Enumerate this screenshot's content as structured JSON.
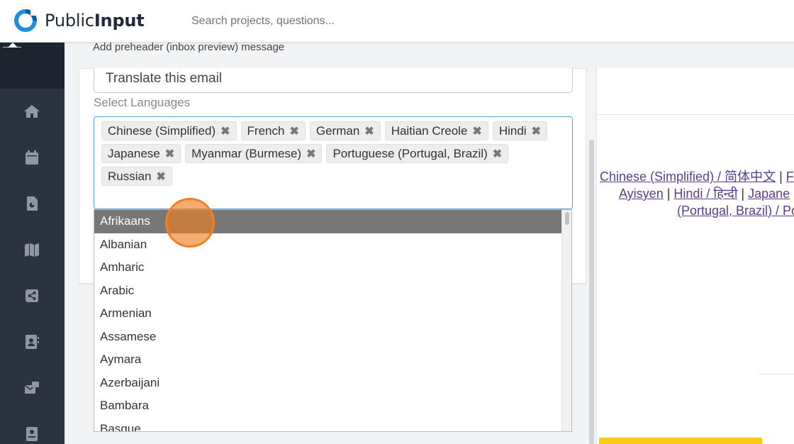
{
  "header": {
    "brand_part1": "Public",
    "brand_part2": "Input",
    "search_placeholder": "Search projects, questions..."
  },
  "sidebar": {
    "items": [
      {
        "name": "home-icon"
      },
      {
        "name": "calendar-icon"
      },
      {
        "name": "document-icon"
      },
      {
        "name": "map-icon"
      },
      {
        "name": "share-icon"
      },
      {
        "name": "contacts-icon"
      },
      {
        "name": "email-icon"
      },
      {
        "name": "book-icon"
      }
    ]
  },
  "main": {
    "preheader_label": "Add preheader (inbox preview) message",
    "translate_label": "Translate this email",
    "select_label": "Select Languages",
    "selected_languages": [
      "Chinese (Simplified)",
      "French",
      "German",
      "Haitian Creole",
      "Hindi",
      "Japanese",
      "Myanmar (Burmese)",
      "Portuguese (Portugal, Brazil)",
      "Russian"
    ],
    "tag_remove_glyph": "✖",
    "dropdown_options": [
      "Afrikaans",
      "Albanian",
      "Amharic",
      "Arabic",
      "Armenian",
      "Assamese",
      "Aymara",
      "Azerbaijani",
      "Bambara",
      "Basque"
    ],
    "highlighted_option": "Afrikaans"
  },
  "preview": {
    "line1_link1": "Chinese (Simplified) / 简体中文",
    "line1_sep": " | ",
    "line1_link2": "F",
    "line2_link1": "Ayisyen",
    "line2_sep1": " | ",
    "line2_link2": "Hindi / हिन्दी",
    "line2_sep2": " | ",
    "line2_link3": "Japane",
    "line3_link1": "(Portugal, Brazil) / Po"
  },
  "colors": {
    "sidebar_bg": "#2b3240",
    "link_purple": "#5a3e8c",
    "focus_blue": "#5b9bd5",
    "highlight_gray": "#777777",
    "brand_blue": "#1f8ee0",
    "click_orange": "#f08024",
    "accent_yellow": "#f5cd1a"
  }
}
